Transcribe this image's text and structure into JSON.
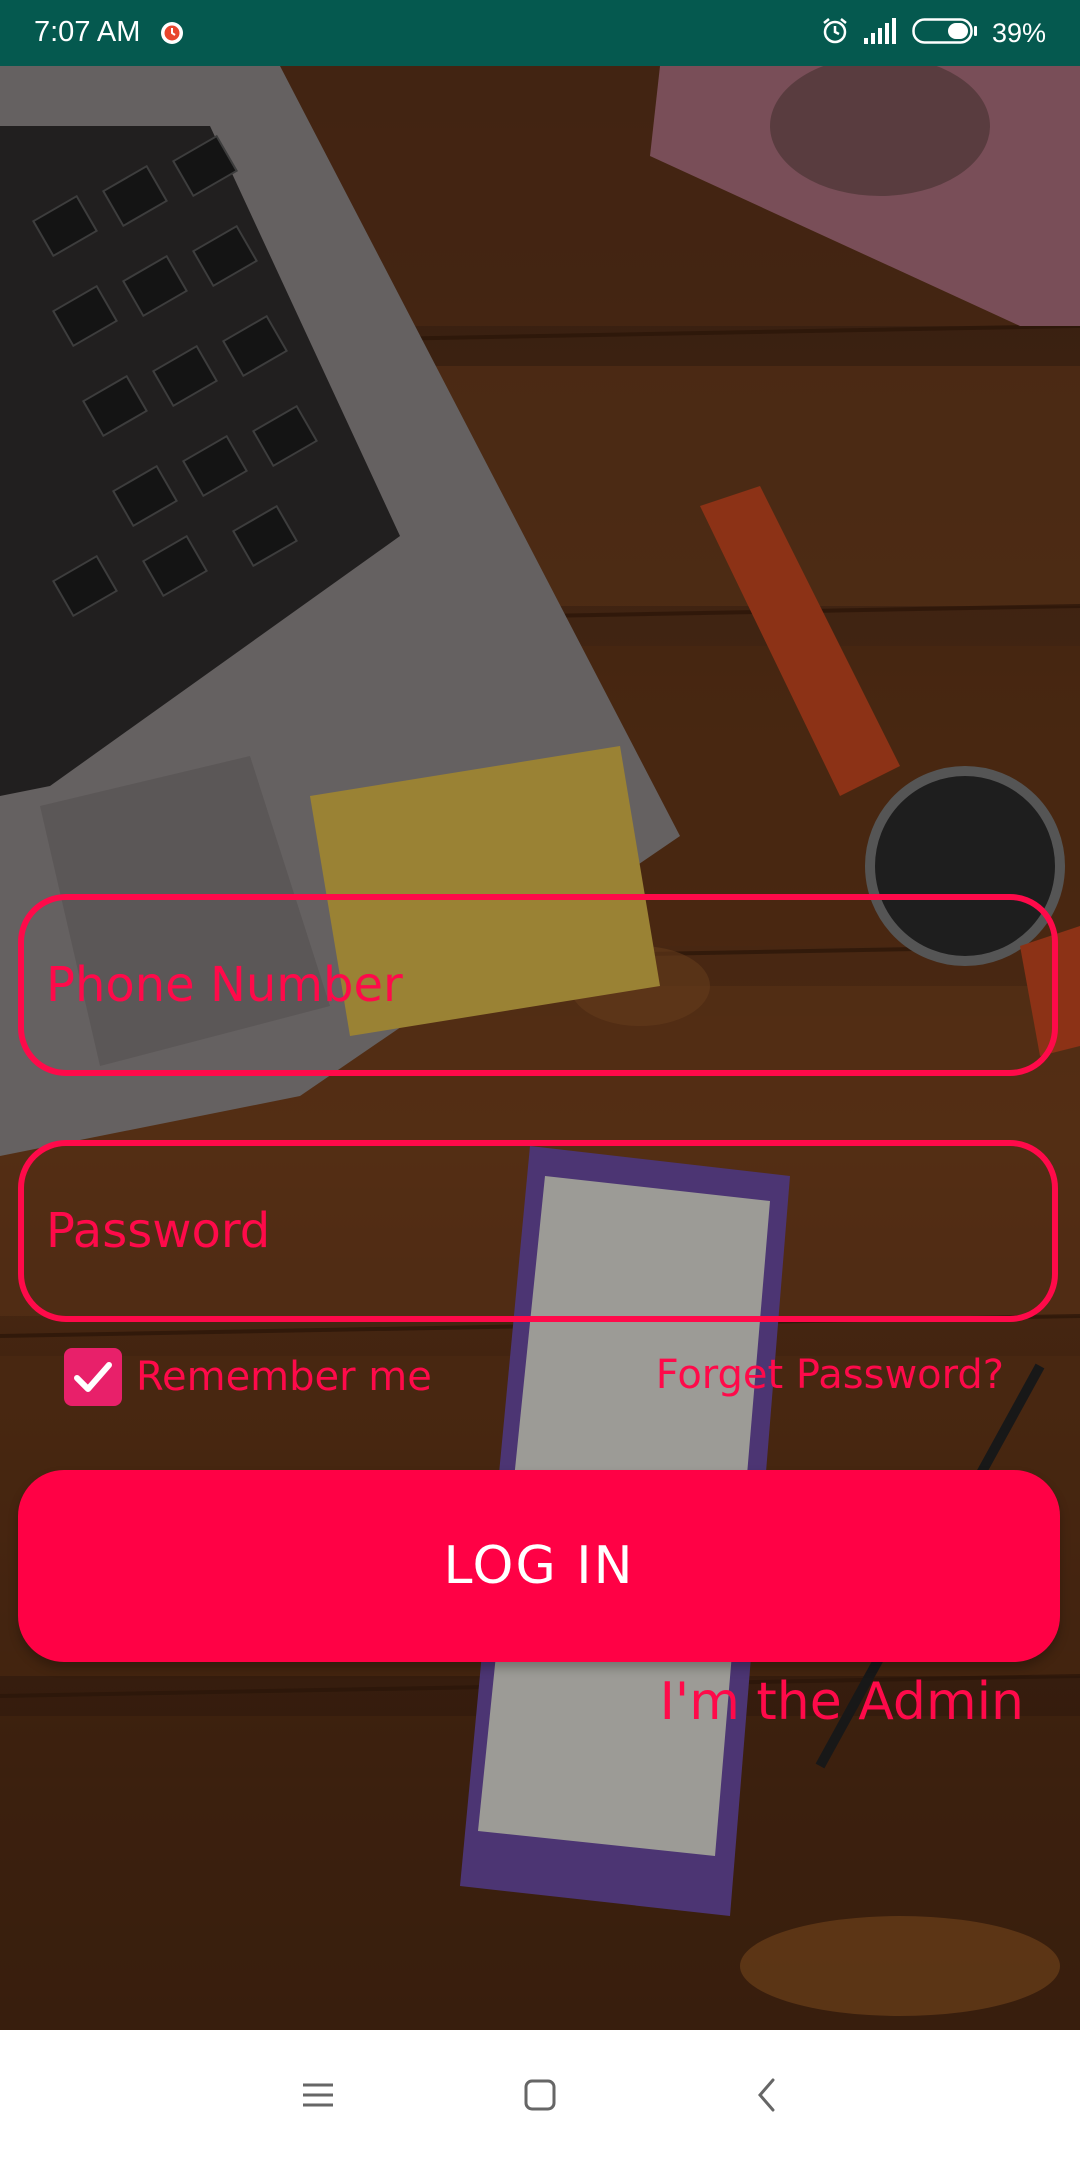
{
  "status_bar": {
    "time": "7:07 AM",
    "battery_percent": "39%",
    "icons": [
      "alarm-icon",
      "alarm-clock-icon",
      "signal-icon",
      "battery-icon"
    ]
  },
  "form": {
    "phone": {
      "placeholder": "Phone Number",
      "value": ""
    },
    "password": {
      "placeholder": "Password",
      "value": ""
    },
    "remember_me": {
      "label": "Remember me",
      "checked": true
    },
    "forget_password": "Forget Password?",
    "login_button": "LOG IN",
    "admin_link": "I'm the Admin"
  },
  "colors": {
    "accent": "#ff0a4a",
    "button": "#ff0145",
    "status_bar": "#05594f"
  },
  "nav_bar": {
    "icons": [
      "menu-icon",
      "home-icon",
      "back-icon"
    ]
  }
}
